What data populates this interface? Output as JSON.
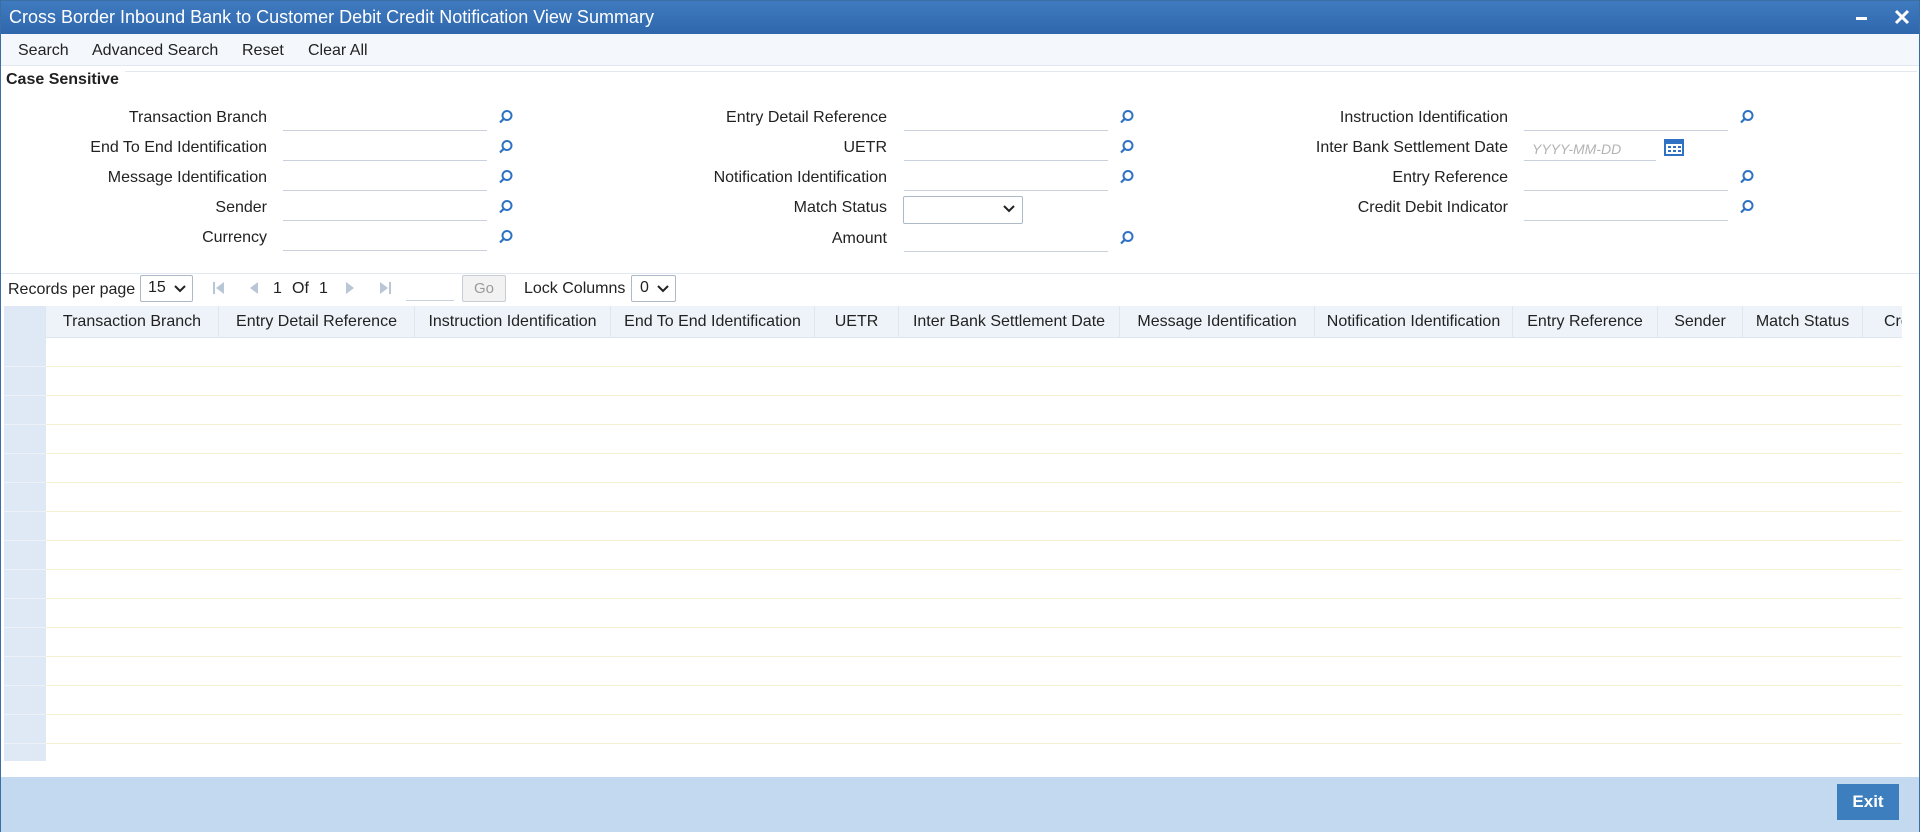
{
  "window": {
    "title": "Cross Border Inbound Bank to Customer Debit Credit Notification View Summary",
    "minimize_icon": "minimize-icon",
    "close_icon": "close-icon"
  },
  "toolbar": {
    "search": "Search",
    "advanced_search": "Advanced Search",
    "reset": "Reset",
    "clear_all": "Clear All"
  },
  "criteria": {
    "legend": "Case Sensitive",
    "transaction_branch": "Transaction Branch",
    "end_to_end_identification": "End To End Identification",
    "message_identification": "Message Identification",
    "sender": "Sender",
    "currency": "Currency",
    "entry_detail_reference": "Entry Detail Reference",
    "uetr": "UETR",
    "notification_identification": "Notification Identification",
    "match_status": "Match Status",
    "match_status_value": "",
    "amount": "Amount",
    "instruction_identification": "Instruction Identification",
    "inter_bank_settlement_date": "Inter Bank Settlement Date",
    "date_placeholder": "YYYY-MM-DD",
    "entry_reference": "Entry Reference",
    "credit_debit_indicator": "Credit Debit Indicator"
  },
  "pager": {
    "records_per_page_label": "Records per page",
    "records_per_page_value": "15",
    "current_page": "1",
    "of_label": "Of",
    "total_pages": "1",
    "go_label": "Go",
    "lock_columns_label": "Lock Columns",
    "lock_columns_value": "0"
  },
  "grid": {
    "columns": [
      "Transaction Branch",
      "Entry Detail Reference",
      "Instruction Identification",
      "End To End Identification",
      "UETR",
      "Inter Bank Settlement Date",
      "Message Identification",
      "Notification Identification",
      "Entry Reference",
      "Sender",
      "Match Status",
      "Cre"
    ],
    "empty_row_count": 15
  },
  "footer": {
    "exit_label": "Exit"
  },
  "colors": {
    "titlebar": "#2f67ad",
    "footer": "#c3d9ef",
    "exit_button": "#3d7ebf",
    "icon_blue": "#2f72c4"
  }
}
